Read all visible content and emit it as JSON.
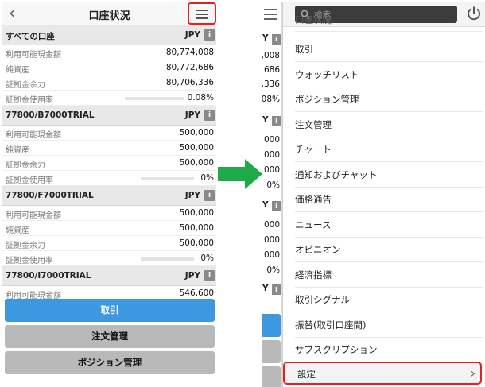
{
  "left": {
    "header": {
      "title": "口座状況",
      "back_glyph": "‹"
    },
    "accounts": [
      {
        "name": "すべての口座",
        "currency": "JPY",
        "info_glyph": "i",
        "rows": [
          {
            "label": "利用可能現金額",
            "value": "80,774,008"
          },
          {
            "label": "純資産",
            "value": "80,772,686"
          },
          {
            "label": "証拠金余力",
            "value": "80,706,336"
          },
          {
            "label": "証拠金使用率",
            "value": "0.08%",
            "bar": true
          }
        ]
      },
      {
        "name": "77800/B7000TRIAL",
        "currency": "JPY",
        "info_glyph": "i",
        "rows": [
          {
            "label": "利用可能現金額",
            "value": "500,000"
          },
          {
            "label": "純資産",
            "value": "500,000"
          },
          {
            "label": "証拠金余力",
            "value": "500,000"
          },
          {
            "label": "証拠金使用率",
            "value": "0%",
            "bar": true
          }
        ]
      },
      {
        "name": "77800/F7000TRIAL",
        "currency": "JPY",
        "info_glyph": "i",
        "rows": [
          {
            "label": "利用可能現金額",
            "value": "500,000"
          },
          {
            "label": "純資産",
            "value": "500,000"
          },
          {
            "label": "証拠金余力",
            "value": "500,000"
          },
          {
            "label": "証拠金使用率",
            "value": "0%",
            "bar": true
          }
        ]
      },
      {
        "name": "77800/I7000TRIAL",
        "currency": "JPY",
        "info_glyph": "i",
        "rows": [
          {
            "label": "利用可能現金額",
            "value": "546,600"
          }
        ]
      }
    ],
    "buttons": {
      "trade": "取引",
      "order": "注文管理",
      "position": "ポジション管理"
    }
  },
  "right": {
    "strip": {
      "values": [
        ",008",
        "686",
        ",336",
        "08%",
        "000",
        "000",
        "000",
        "0%",
        "000",
        "000",
        "000",
        "0%"
      ],
      "jpy_glyph": "Y",
      "info_glyph": "i"
    },
    "search": {
      "placeholder": "検索"
    },
    "menu_items": [
      "口座状況",
      "取引",
      "ウォッチリスト",
      "ポジション管理",
      "注文管理",
      "チャート",
      "通知およびチャット",
      "価格通告",
      "ニュース",
      "オピニオン",
      "経済指標",
      "取引シグナル",
      "振替(取引口座間)",
      "サブスクリプション"
    ],
    "settings": {
      "label": "設定",
      "chevron": "›"
    }
  },
  "colors": {
    "highlight": "#e52020",
    "primary": "#3d98e0",
    "arrow": "#1faa4a"
  },
  "icons": {
    "menu": "hamburger-icon",
    "search": "search-icon",
    "power": "power-icon",
    "back": "chevron-left-icon",
    "info": "info-icon"
  }
}
